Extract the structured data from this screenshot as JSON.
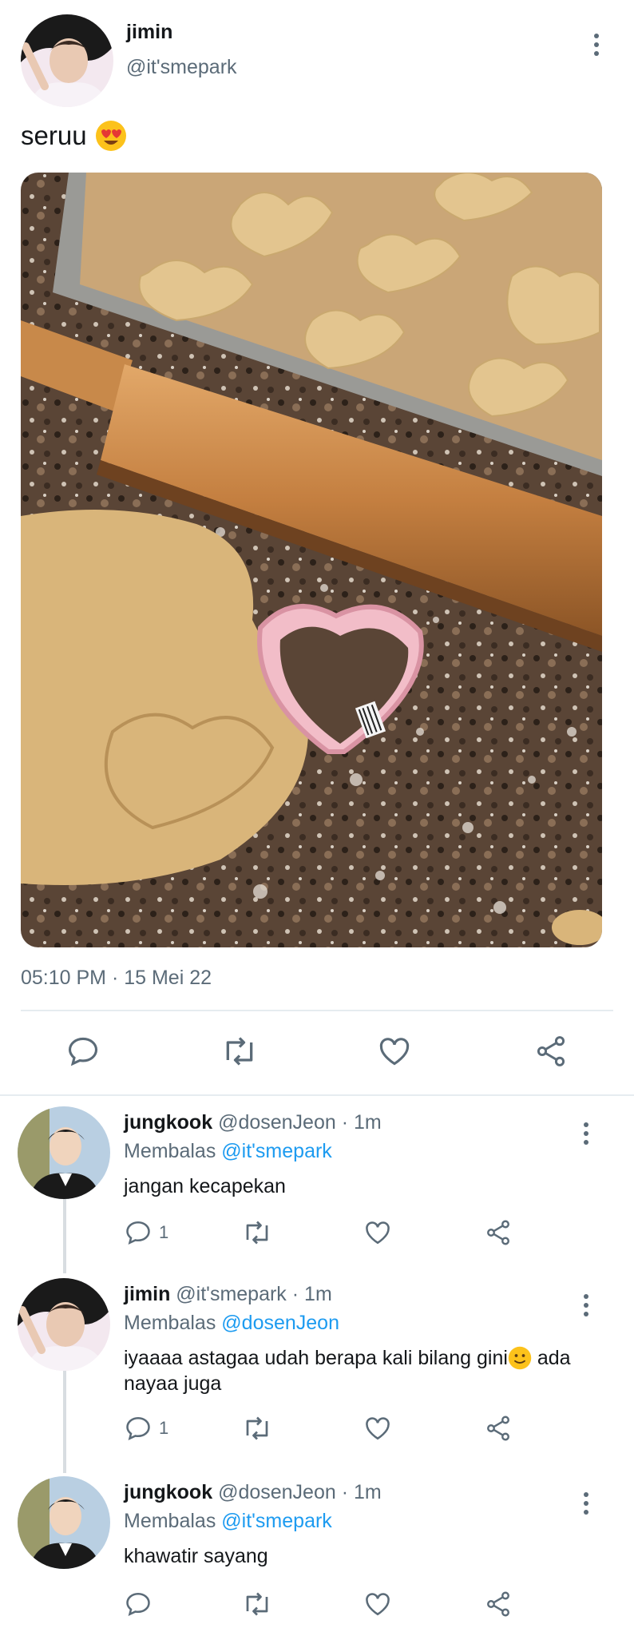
{
  "tweet": {
    "author_name": "jimin",
    "author_handle": "@it'smepark",
    "text": "seruu",
    "emoji": "heart-eyes-emoji",
    "timestamp": "05:10 PM · 15 Mei 22"
  },
  "replies": [
    {
      "name": "jungkook",
      "handle": "@dosenJeon",
      "time": "1m",
      "replying_prefix": "Membalas",
      "replying_to": "@it'smepark",
      "text": "jangan kecapekan",
      "reply_count": "1"
    },
    {
      "name": "jimin",
      "handle": "@it'smepark",
      "time": "1m",
      "replying_prefix": "Membalas",
      "replying_to": "@dosenJeon",
      "text_line1": "iyaaaa astagaa udah berapa kali bilang gini",
      "text_line1_after": " ada",
      "text_line2": "nayaa juga",
      "reply_count": "1"
    },
    {
      "name": "jungkook",
      "handle": "@dosenJeon",
      "time": "1m",
      "replying_prefix": "Membalas",
      "replying_to": "@it'smepark",
      "text": "khawatir sayang",
      "reply_count": ""
    }
  ],
  "icons": {
    "reply": "reply-icon",
    "retweet": "retweet-icon",
    "like": "heart-icon",
    "share": "share-icon",
    "more": "more-vertical-icon"
  },
  "colors": {
    "mention": "#1d9bf0",
    "secondary": "#5b6b78",
    "divider": "#e6ecf0"
  }
}
